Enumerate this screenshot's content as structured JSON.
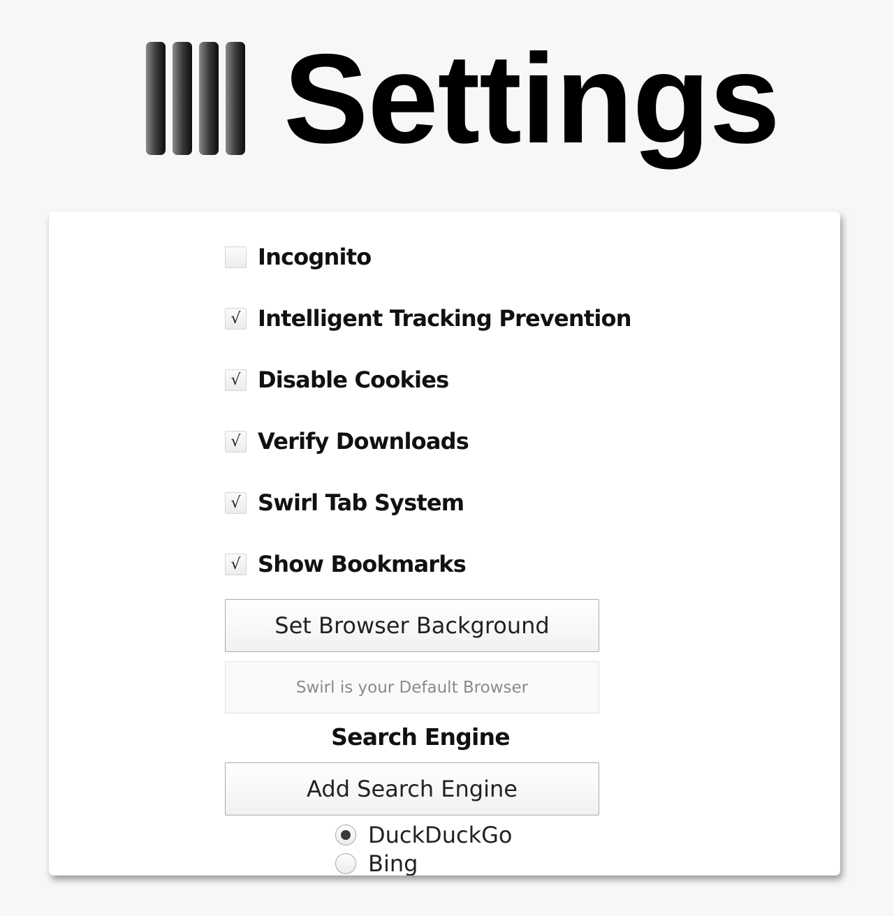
{
  "header": {
    "title": "Settings",
    "logo_icon": "four-bars-logo-icon"
  },
  "options": [
    {
      "label": "Incognito",
      "checked": false
    },
    {
      "label": "Intelligent Tracking Prevention",
      "checked": true
    },
    {
      "label": "Disable Cookies",
      "checked": true
    },
    {
      "label": "Verify Downloads",
      "checked": true
    },
    {
      "label": "Swirl Tab System",
      "checked": true
    },
    {
      "label": "Show Bookmarks",
      "checked": true
    }
  ],
  "check_glyph": "√",
  "buttons": {
    "set_background": "Set Browser Background",
    "default_browser": "Swirl is your Default Browser",
    "add_search_engine": "Add Search Engine"
  },
  "search_engine": {
    "title": "Search Engine",
    "engines": [
      {
        "label": "DuckDuckGo",
        "selected": true
      },
      {
        "label": "Bing",
        "selected": false
      }
    ]
  }
}
